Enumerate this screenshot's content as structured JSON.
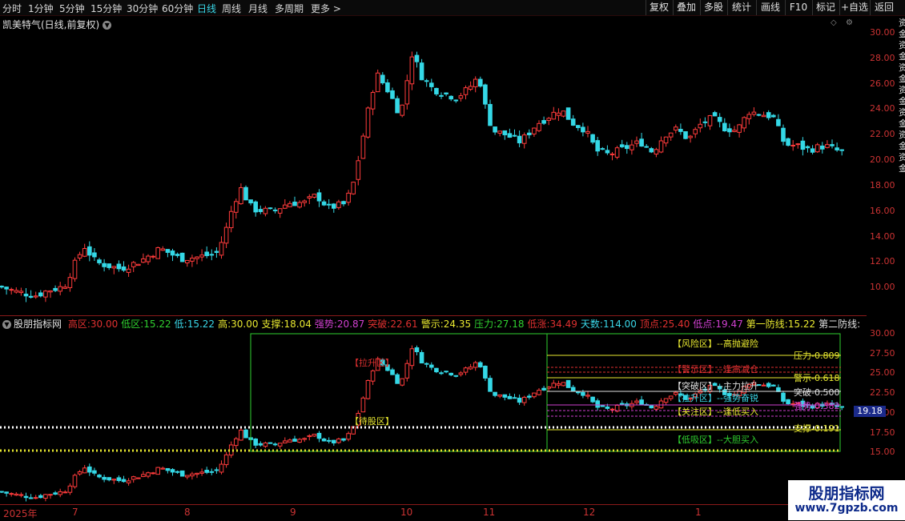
{
  "toolbar": {
    "periods": [
      "分时",
      "1分钟",
      "5分钟",
      "15分钟",
      "30分钟",
      "60分钟",
      "日线",
      "周线",
      "月线",
      "多周期",
      "更多 >"
    ],
    "active_period": "日线",
    "right": [
      "复权",
      "叠加",
      "多股",
      "统计",
      "画线",
      "F10",
      "标记",
      "+自选",
      "返回"
    ]
  },
  "main_chart": {
    "title": "凯美特气(日线,前复权)",
    "y_ticks": [
      "30.00",
      "28.00",
      "26.00",
      "24.00",
      "22.00",
      "20.00",
      "18.00",
      "16.00",
      "14.00",
      "12.00",
      "10.00"
    ]
  },
  "indicator": {
    "name": "股朋指标网",
    "items": [
      {
        "label": "高区:",
        "value": "30.00",
        "color": "#e03030"
      },
      {
        "label": "低区:",
        "value": "15.22",
        "color": "#30d030"
      },
      {
        "label": "低:",
        "value": "15.22",
        "color": "#3ad7e8"
      },
      {
        "label": "高:",
        "value": "30.00",
        "color": "#e8e830"
      },
      {
        "label": "支撑:",
        "value": "18.04",
        "color": "#e8e830"
      },
      {
        "label": "强势:",
        "value": "20.87",
        "color": "#d040d0"
      },
      {
        "label": "突破:",
        "value": "22.61",
        "color": "#e03030"
      },
      {
        "label": "警示:",
        "value": "24.35",
        "color": "#e8e830"
      },
      {
        "label": "压力:",
        "value": "27.18",
        "color": "#30d030"
      },
      {
        "label": "低涨:",
        "value": "34.49",
        "color": "#e03030"
      },
      {
        "label": "天数:",
        "value": "114.00",
        "color": "#3ad7e8"
      },
      {
        "label": "顶点:",
        "value": "25.40",
        "color": "#e03030"
      },
      {
        "label": "低点:",
        "value": "19.47",
        "color": "#d040d0"
      },
      {
        "label": "第一防线:",
        "value": "15.22",
        "color": "#e8e830"
      },
      {
        "label": "第二防线:",
        "value": "",
        "color": "#e0e0e0"
      }
    ],
    "y_ticks": [
      "30.00",
      "27.50",
      "25.00",
      "22.50",
      "20.00",
      "17.50",
      "15.00"
    ],
    "current_price": "19.18",
    "zones": [
      {
        "text": "【风险区】--高抛避险",
        "color": "#e8e830"
      },
      {
        "text": "【警示区】--逢高减仓",
        "color": "#e03030"
      },
      {
        "text": "【突破区】--主力拉升",
        "color": "#e0e0e0"
      },
      {
        "text": "【拉升区】--强势奋锐",
        "color": "#3ad7e8"
      },
      {
        "text": "【关注区】--逢低买入",
        "color": "#e8e830"
      },
      {
        "text": "【低吸区】--大胆买入",
        "color": "#30d030"
      }
    ],
    "levels": [
      {
        "text": "压力-0.809",
        "color": "#e8e830"
      },
      {
        "text": "警示-0.618",
        "color": "#e8e830"
      },
      {
        "text": "突破-0.500",
        "color": "#e0e0e0"
      },
      {
        "text": "强势-0.382",
        "color": "#d040d0"
      },
      {
        "text": "支撑-0.191",
        "color": "#e8e830"
      }
    ],
    "tags": [
      {
        "text": "【拉升区】",
        "color": "#e03030"
      },
      {
        "text": "【待股区】",
        "color": "#e8e830"
      }
    ]
  },
  "dates": [
    "2025年",
    "7",
    "8",
    "9",
    "10",
    "11",
    "12",
    "1"
  ],
  "right_rail_text": "资金资金资金资金资金资金资金",
  "watermark": {
    "line1": "股朋指标网",
    "line2": "www.7gpzb.com"
  }
}
